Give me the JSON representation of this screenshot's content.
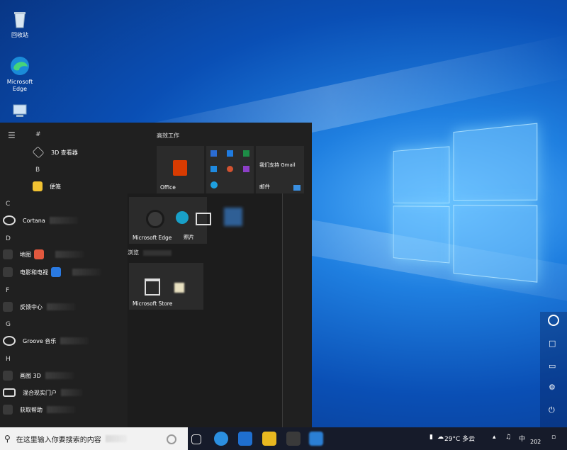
{
  "desktop": {
    "icons": [
      {
        "label": "回收站",
        "icon": "recycle-bin-icon"
      },
      {
        "label": "Microsoft Edge",
        "icon": "edge-icon"
      },
      {
        "label": "",
        "icon": "computer-icon"
      }
    ]
  },
  "start_menu": {
    "rail": {
      "menu_icon": "hamburger-icon"
    },
    "sections": {
      "hash": "#",
      "b": "B",
      "c": "C",
      "d": "D",
      "f": "F",
      "g": "G",
      "h": "H"
    },
    "apps": [
      {
        "name": "3D 查看器",
        "icon": "cube-icon",
        "color": "#3a3a3a"
      },
      {
        "name": "便笺",
        "icon": "sticky-notes-icon",
        "color": "#f1c232"
      },
      {
        "name": "Cortana",
        "icon": "cortana-icon",
        "color": "#202020"
      },
      {
        "name": "地图",
        "icon": "maps-icon",
        "color": "#e2583e"
      },
      {
        "name": "电影和电视",
        "icon": "movies-icon",
        "color": "#2a7ae2"
      },
      {
        "name": "反馈中心",
        "icon": "feedback-icon",
        "color": "#3a3a3a"
      },
      {
        "name": "Groove 音乐",
        "icon": "groove-icon",
        "color": "#3a3a3a"
      },
      {
        "name": "画图 3D",
        "icon": "paint3d-icon",
        "color": "#6a3ad0"
      },
      {
        "name": "混合现实门户",
        "icon": "mixed-reality-icon",
        "color": "#3a3a3a"
      },
      {
        "name": "获取帮助",
        "icon": "help-icon",
        "color": "#3a3a3a"
      }
    ],
    "groups": {
      "productivity": "高效工作",
      "browse": "浏览"
    },
    "tiles": {
      "office": "Office",
      "gmail": "我们支持 Gmail",
      "mail": "邮件",
      "edge": "Microsoft Edge",
      "photos": "照片",
      "store": "Microsoft Store"
    }
  },
  "taskbar": {
    "search_placeholder": "在这里输入你要搜索的内容",
    "weather": "29°C 多云",
    "ime": "中",
    "time": "202"
  },
  "colors": {
    "accent": "#0a78d7",
    "start_bg": "#202020",
    "tile_bg": "#2b2b2b",
    "office_red": "#d83b01"
  }
}
